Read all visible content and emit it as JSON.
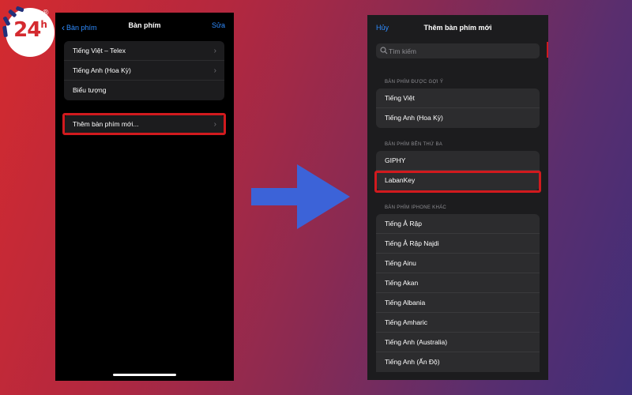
{
  "logo": {
    "text": "24",
    "sup": "h",
    "reg": "®",
    "color": "#d42a2f"
  },
  "left_phone": {
    "back_label": "Bàn phím",
    "title": "Bàn phím",
    "edit_label": "Sửa",
    "keyboards": [
      {
        "label": "Tiếng Việt – Telex"
      },
      {
        "label": "Tiếng Anh (Hoa Kỳ)"
      },
      {
        "label": "Biểu tượng"
      }
    ],
    "add_keyboard_label": "Thêm bàn phím mới..."
  },
  "right_phone": {
    "cancel_label": "Hủy",
    "title": "Thêm bàn phím mới",
    "search_placeholder": "Tìm kiếm",
    "suggested_header": "BÀN PHÍM ĐƯỢC GỢI Ý",
    "suggested": [
      {
        "label": "Tiếng Việt"
      },
      {
        "label": "Tiếng Anh (Hoa Kỳ)"
      }
    ],
    "third_party_header": "BÀN PHÍM BÊN THỨ BA",
    "third_party": [
      {
        "label": "GIPHY"
      },
      {
        "label": "LabanKey"
      }
    ],
    "other_header": "BÀN PHÍM IPHONE KHÁC",
    "other": [
      {
        "label": "Tiếng Ả Rập"
      },
      {
        "label": "Tiếng Ả Rập Najdi"
      },
      {
        "label": "Tiếng Ainu"
      },
      {
        "label": "Tiếng Akan"
      },
      {
        "label": "Tiếng Albania"
      },
      {
        "label": "Tiếng Amharic"
      },
      {
        "label": "Tiếng Anh (Australia)"
      },
      {
        "label": "Tiếng Anh (Ấn Độ)"
      }
    ]
  },
  "colors": {
    "accent": "#2f8cff",
    "highlight": "#d11a1e",
    "arrow": "#3c63d8"
  }
}
